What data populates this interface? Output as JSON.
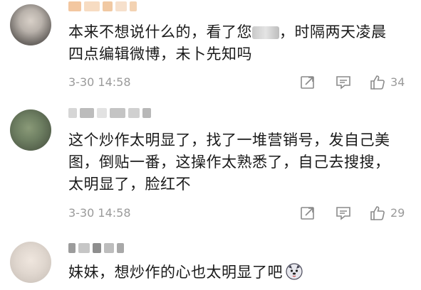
{
  "comments": [
    {
      "text_line1_before": "本来不想说什么的，看了您",
      "text_line1_after": "，时隔两天凌晨",
      "text_line2": "四点编辑微博，未卜先知吗",
      "time": "3-30 14:58",
      "likes": "34"
    },
    {
      "text_line1": "这个炒作太明显了，找了一堆营销号，发自己美",
      "text_line2": "图，倒贴一番，这操作太熟悉了，自己去搜搜，",
      "text_line3": "太明显了，脸红不",
      "time": "3-30 14:58",
      "likes": "29"
    },
    {
      "text_line1": "妹妹，想炒作的心也太明显了吧",
      "emoji": "dog-face-emoji"
    }
  ],
  "icons": {
    "share": "share-icon",
    "comment": "comment-icon",
    "like": "thumbs-up-icon"
  },
  "colors": {
    "meta_gray": "#9a9a9a",
    "text": "#1a1a1a"
  }
}
